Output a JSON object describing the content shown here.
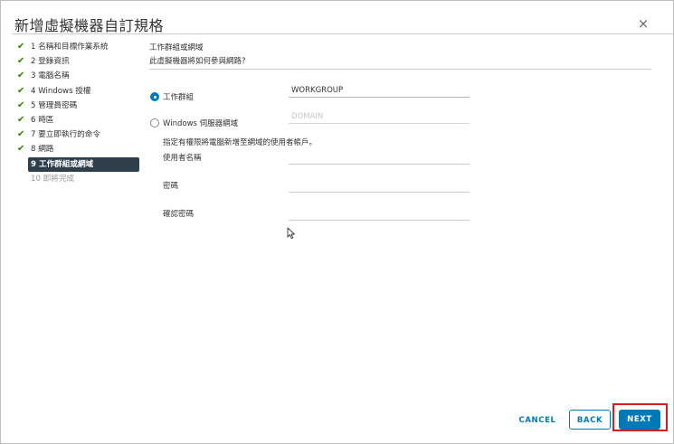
{
  "dialog": {
    "title": "新增虛擬機器自訂規格",
    "close_glyph": "×"
  },
  "steps": [
    {
      "label": "1 名稱和目標作業系統",
      "status": "done"
    },
    {
      "label": "2 登錄資訊",
      "status": "done"
    },
    {
      "label": "3 電腦名稱",
      "status": "done"
    },
    {
      "label": "4 Windows 授權",
      "status": "done"
    },
    {
      "label": "5 管理員密碼",
      "status": "done"
    },
    {
      "label": "6 時區",
      "status": "done"
    },
    {
      "label": "7 要立即執行的命令",
      "status": "done"
    },
    {
      "label": "8 網路",
      "status": "done"
    },
    {
      "label": "9 工作群組或網域",
      "status": "active"
    },
    {
      "label": "10 即將完成",
      "status": "pending"
    }
  ],
  "content": {
    "section_title": "工作群組或網域",
    "section_subtitle": "此虛擬機器將如何參與網路?",
    "workgroup_option": {
      "label": "工作群組",
      "selected": true,
      "value": "WORKGROUP"
    },
    "domain_option": {
      "label": "Windows 伺服器網域",
      "selected": false,
      "placeholder": "DOMAIN"
    },
    "credentials_hint": "指定有權限將電腦新增至網域的使用者帳戶。",
    "username_label": "使用者名稱",
    "username_value": "",
    "password_label": "密碼",
    "password_value": "",
    "confirm_password_label": "確認密碼",
    "confirm_password_value": ""
  },
  "footer": {
    "cancel_label": "CANCEL",
    "back_label": "BACK",
    "next_label": "NEXT"
  },
  "colors": {
    "accent": "#0079b8",
    "check": "#2f8400",
    "active_step_bg": "#2f3e4b",
    "highlight": "#d32027"
  },
  "icons": {
    "check": "checkmark-icon",
    "close": "close-icon",
    "cursor": "mouse-pointer-icon"
  }
}
